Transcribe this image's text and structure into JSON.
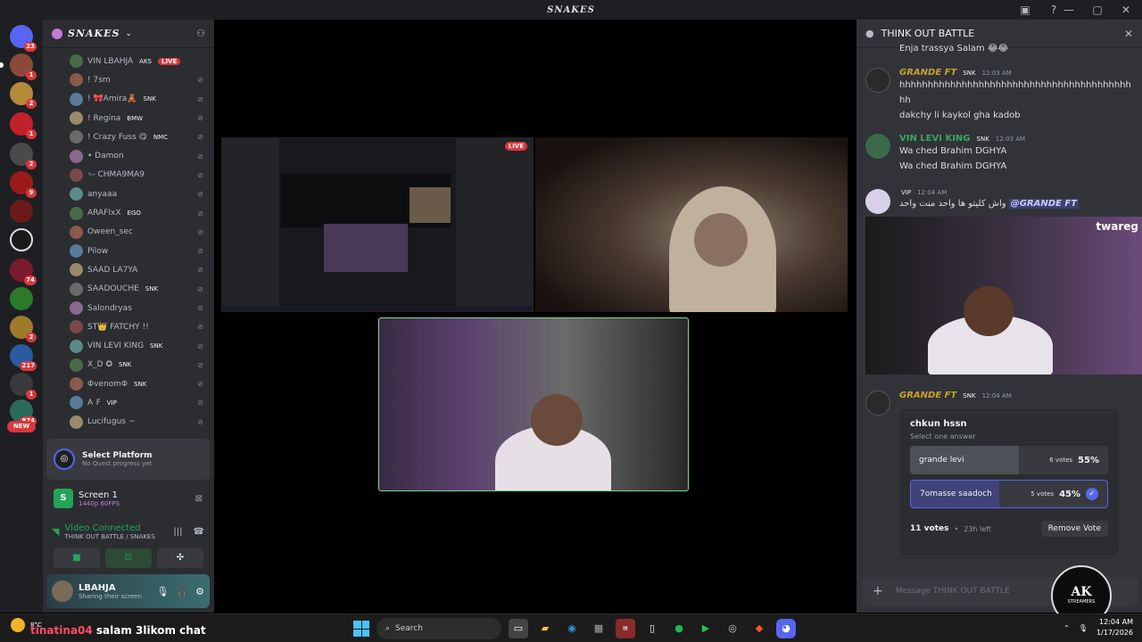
{
  "window": {
    "title": "SNAKES",
    "controls": [
      "—",
      "▢",
      "✕"
    ],
    "icons": [
      "inbox-icon",
      "help-icon"
    ]
  },
  "servers": {
    "badges": [
      "23",
      "1",
      "2",
      "1",
      "2",
      "9",
      "74",
      "2",
      "217",
      "1",
      "874"
    ],
    "new_label": "NEW"
  },
  "guild": {
    "name": "SNAKES",
    "voice_users": [
      {
        "name": "VIN LBAHJA",
        "tag": "AKS",
        "live": "LIVE"
      },
      {
        "name": "! 7sm",
        "tag": ""
      },
      {
        "name": "! 🎀Amira🧸",
        "tag": "SNK"
      },
      {
        "name": "! Regina",
        "tag": "BMW"
      },
      {
        "name": "! Crazy Fuss 😋",
        "tag": "NMC"
      },
      {
        "name": "• Damon",
        "tag": ""
      },
      {
        "name": "ᛃ- CHMA9MA9",
        "tag": ""
      },
      {
        "name": "anyaaa",
        "tag": ""
      },
      {
        "name": "ARAFIxX",
        "tag": "EGO"
      },
      {
        "name": "Oween_sec",
        "tag": ""
      },
      {
        "name": "Pilow",
        "tag": ""
      },
      {
        "name": "SAAD LA7YA",
        "tag": ""
      },
      {
        "name": "SAADOUCHE",
        "tag": "SNK"
      },
      {
        "name": "Salondryas",
        "tag": ""
      },
      {
        "name": "ST👑 FATCHY !!",
        "tag": ""
      },
      {
        "name": "VIN LEVI KING",
        "tag": "SNK"
      },
      {
        "name": "X_D ✪",
        "tag": "SNK"
      },
      {
        "name": "ΦvenomΦ",
        "tag": "SNK"
      },
      {
        "name": "A ₣",
        "tag": "VIP"
      },
      {
        "name": "Lucifugus ~",
        "tag": ""
      }
    ]
  },
  "panels": {
    "quest_title": "Select Platform",
    "quest_sub": "No Quest progress yet",
    "screen_title": "Screen 1",
    "screen_sub": "1440p 60FPS",
    "voice_status": "Video Connected",
    "voice_channel": "THINK OUT BATTLE / SNAKES",
    "user_name": "LBAHJA",
    "user_status": "Sharing their screen"
  },
  "stage": {
    "share_live": "LIVE"
  },
  "chat": {
    "header": "THINK OUT BATTLE",
    "messages": [
      {
        "author": "",
        "time": "",
        "lines": [
          "Enja trassya Salam 😂😂"
        ]
      },
      {
        "author": "GRANDE FT",
        "tag": "SNK",
        "time": "12:03 AM",
        "lines": [
          "hhhhhhhhhhhhhhhhhhhhhhhhhhhhhhhhhhhhhhhhhhh",
          "dakchy li kaykol gha kadob"
        ]
      },
      {
        "author": "VIN LEVI KING",
        "tag": "SNK",
        "time": "12:03 AM",
        "lines": [
          "Wa ched Brahim DGHYA",
          "Wa ched Brahim DGHYA"
        ]
      },
      {
        "author": "",
        "tag": "VIP",
        "time": "12:04 AM",
        "text": "واش كليتو ها واحد منت واحد",
        "mention": "@GRANDE FT"
      },
      {
        "author": "GRANDE FT",
        "tag": "SNK",
        "time": "12:04 AM"
      }
    ],
    "embed_brand": "twareg",
    "poll": {
      "question": "chkun hssn",
      "subtitle": "Select one answer",
      "options": [
        {
          "label": "grande levi",
          "votes": "6 votes",
          "pct": "55%",
          "share": 0.55
        },
        {
          "label": "7omasse saadoch",
          "votes": "5 votes",
          "pct": "45%",
          "share": 0.45
        }
      ],
      "total": "11 votes",
      "time_left": "23h left",
      "remove_label": "Remove Vote"
    },
    "input_placeholder": "Message THINK OUT BATTLE"
  },
  "overlay": {
    "user": "tinatina04",
    "text": "salam 3likom chat",
    "logo_main": "AK",
    "logo_sub": "STREAMERS"
  },
  "taskbar": {
    "temp": "8°C",
    "search": "Search",
    "time": "12:04 AM",
    "date": "1/17/2026"
  },
  "colors": {
    "accent": "#5865f2",
    "live": "#da373c",
    "connected": "#23a559",
    "grande": "#c9a227",
    "levi": "#3ba55d"
  }
}
